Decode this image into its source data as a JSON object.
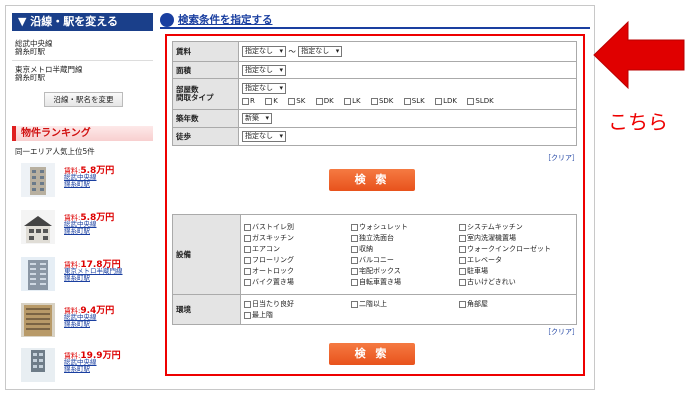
{
  "sidebar": {
    "header": "▼ 沿線・駅を変える",
    "line1_l1": "総武中央線",
    "line1_l2": "錦糸町駅",
    "line2_l1": "東京メトロ半蔵門線",
    "line2_l2": "錦糸町駅",
    "change_button": "沿線・駅名を変更",
    "ranking_title": "物件ランキング",
    "ranking_sub": "同一エリア人気上位5件",
    "ranking": [
      {
        "price_label": "賃料:",
        "price": "5.8万円",
        "line": "総武中央線",
        "station": "錦糸町駅"
      },
      {
        "price_label": "賃料:",
        "price": "5.8万円",
        "line": "総武中央線",
        "station": "錦糸町駅"
      },
      {
        "price_label": "賃料:",
        "price": "17.8万円",
        "line": "東京メトロ半蔵門線",
        "station": "錦糸町駅"
      },
      {
        "price_label": "賃料:",
        "price": "9.4万円",
        "line": "総武中央線",
        "station": "錦糸町駅"
      },
      {
        "price_label": "賃料:",
        "price": "19.9万円",
        "line": "総武中央線",
        "station": "錦糸町駅"
      }
    ]
  },
  "main": {
    "title": "検索条件を指定する",
    "rent_label": "賃料",
    "rent_min": "指定なし",
    "rent_sep": "〜",
    "rent_max": "指定なし",
    "area_label": "面積",
    "area_value": "指定なし",
    "layout_label": "部屋数\n間取タイプ",
    "layout_value": "指定なし",
    "layout_types": [
      "R",
      "K",
      "SK",
      "DK",
      "LK",
      "SDK",
      "SLK",
      "LDK",
      "SLDK"
    ],
    "age_label": "築年数",
    "age_value": "新築",
    "walk_label": "徒歩",
    "walk_value": "指定なし",
    "clear_label": "［クリア］",
    "search_label": "検 索",
    "equip_label": "設備",
    "equip": [
      "バストイレ別",
      "ウォシュレット",
      "システムキッチン",
      "ガスキッチン",
      "独立洗面台",
      "室内洗濯機置場",
      "エアコン",
      "収納",
      "ウォークインクローゼット",
      "フローリング",
      "バルコニー",
      "エレベータ",
      "オートロック",
      "宅配ボックス",
      "駐車場",
      "バイク置き場",
      "自転車置き場",
      "古いけどきれい"
    ],
    "env_label": "環境",
    "env": [
      "日当たり良好",
      "二階以上",
      "角部屋",
      "最上階"
    ]
  },
  "callout": {
    "text": "こちら",
    "color": "#e00000"
  }
}
